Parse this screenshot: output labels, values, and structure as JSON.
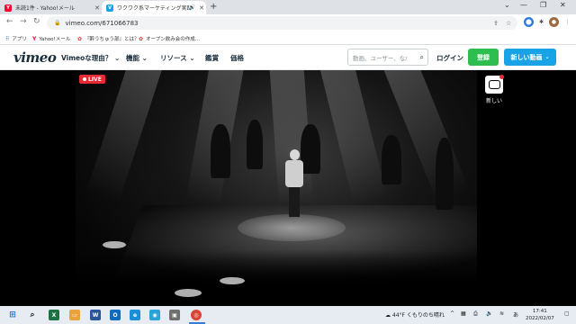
{
  "browser": {
    "tabs": [
      {
        "title": "未読1件 - Yahoo!メール",
        "active": false
      },
      {
        "title": "ワクワク系マーケティング実践会",
        "active": true
      }
    ],
    "new_tab": "+",
    "address": "vimeo.com/671066783",
    "bookmarks": [
      {
        "label": "アプリ",
        "icon": "apps-grid-icon"
      },
      {
        "label": "Yahoo!メール",
        "icon": "yahoo-icon"
      },
      {
        "label": "『酔うちゅう部』とは？",
        "icon": "bookmark-page-icon"
      },
      {
        "label": "オープン飲み会の作成...",
        "icon": "bookmark-page-icon"
      }
    ]
  },
  "vimeo": {
    "logo": "vimeo",
    "menu": [
      {
        "label": "Vimeoな理由？",
        "chevron": true
      },
      {
        "label": "機能",
        "chevron": true
      },
      {
        "label": "リソース",
        "chevron": true
      },
      {
        "label": "鑑賞",
        "chevron": false
      },
      {
        "label": "価格",
        "chevron": false
      }
    ],
    "search_placeholder": "動画、ユーザー、な/",
    "login": "ログイン",
    "join": "登録",
    "new_video": "新しい動画"
  },
  "player": {
    "live_label": "LIVE",
    "new_badge_label": "新しい"
  },
  "taskbar": {
    "weather": "44°F くもりのち晴れ",
    "ime": "あ",
    "time": "17:41",
    "date": "2022/02/07",
    "colors": {
      "accent": "#3a7bd5"
    }
  },
  "colors": {
    "vimeo_green": "#2ebd4f",
    "vimeo_blue": "#17a3e6",
    "live_red": "#e62b36"
  }
}
